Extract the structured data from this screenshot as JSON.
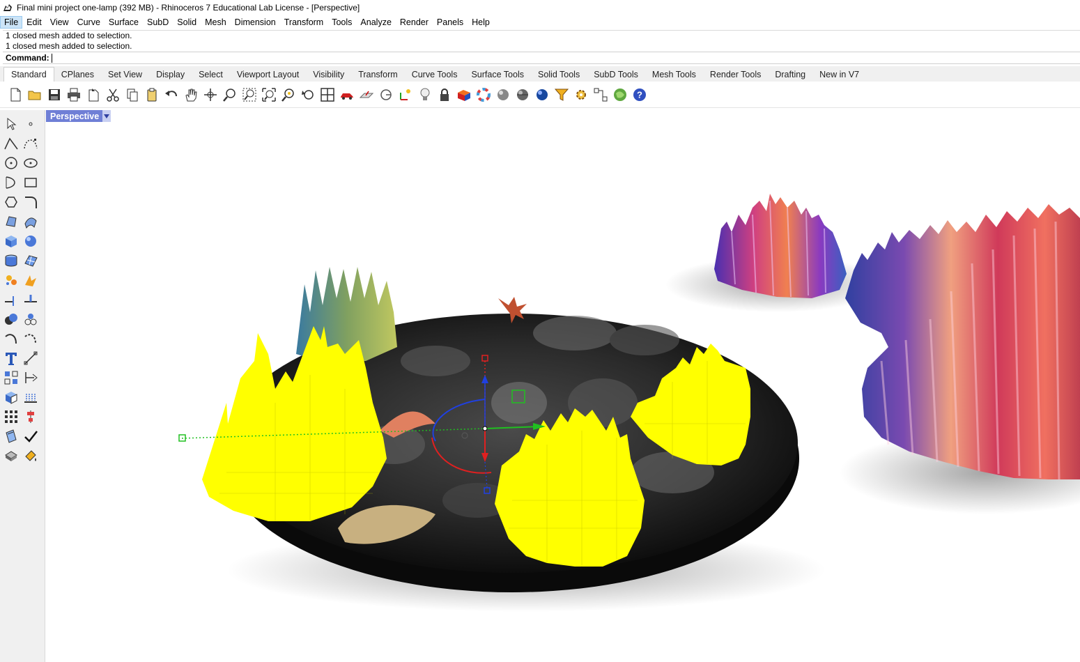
{
  "window": {
    "title": "Final mini project one-lamp (392 MB) - Rhinoceros 7 Educational Lab License - [Perspective]"
  },
  "menu": [
    "File",
    "Edit",
    "View",
    "Curve",
    "Surface",
    "SubD",
    "Solid",
    "Mesh",
    "Dimension",
    "Transform",
    "Tools",
    "Analyze",
    "Render",
    "Panels",
    "Help"
  ],
  "history": [
    "1 closed mesh added to selection.",
    "1 closed mesh added to selection."
  ],
  "command": {
    "label": "Command:",
    "value": ""
  },
  "tabs": [
    "Standard",
    "CPlanes",
    "Set View",
    "Display",
    "Select",
    "Viewport Layout",
    "Visibility",
    "Transform",
    "Curve Tools",
    "Surface Tools",
    "Solid Tools",
    "SubD Tools",
    "Mesh Tools",
    "Render Tools",
    "Drafting",
    "New in V7"
  ],
  "active_tab": "Standard",
  "toolbar_icons": [
    "new-file-icon",
    "open-folder-icon",
    "save-icon",
    "print-icon",
    "import-icon",
    "cut-icon",
    "copy-icon",
    "paste-icon",
    "undo-icon",
    "pan-hand-icon",
    "rotate-view-icon",
    "zoom-dynamic-icon",
    "zoom-window-icon",
    "zoom-extents-icon",
    "zoom-selected-icon",
    "undo-view-icon",
    "four-viewports-icon",
    "car-icon",
    "cplane-icon",
    "osnap-icon",
    "gumball-icon",
    "light-bulb-icon",
    "lock-icon",
    "material-icon",
    "color-wheel-icon",
    "render-sphere-icon",
    "shaded-sphere-icon",
    "rendered-sphere-icon",
    "filter-icon",
    "settings-gear-icon",
    "grasshopper-grid-icon",
    "world-globe-icon",
    "help-icon"
  ],
  "sidebar_icons": [
    "select-arrow-icon",
    "point-icon",
    "polyline-icon",
    "curve-icon",
    "circle-icon",
    "ellipse-icon",
    "arc-icon",
    "rectangle-icon",
    "polygon-icon",
    "fillet-curve-icon",
    "surface-corner-icon",
    "surface-network-icon",
    "box-icon",
    "sphere-icon",
    "cylinder-icon",
    "mesh-surface-icon",
    "explode-icon",
    "boolean-split-icon",
    "extend-icon",
    "split-icon",
    "boolean-union-icon",
    "point-cloud-icon",
    "fillet-icon",
    "blend-icon",
    "text-icon",
    "dimension-icon",
    "block-icon",
    "dimension-aligned-icon",
    "box-edit-icon",
    "grid-snap-icon",
    "array-icon",
    "align-icon",
    "layer-icon",
    "checkmark-icon",
    "solid-icon",
    "paint-bucket-icon"
  ],
  "viewport": {
    "label": "Perspective"
  },
  "colors": {
    "viewport_tab": "#6f7fd6",
    "selection_yellow": "#ffff00",
    "gumball_red": "#e02020",
    "gumball_green": "#20c020",
    "gumball_blue": "#2040e0"
  }
}
